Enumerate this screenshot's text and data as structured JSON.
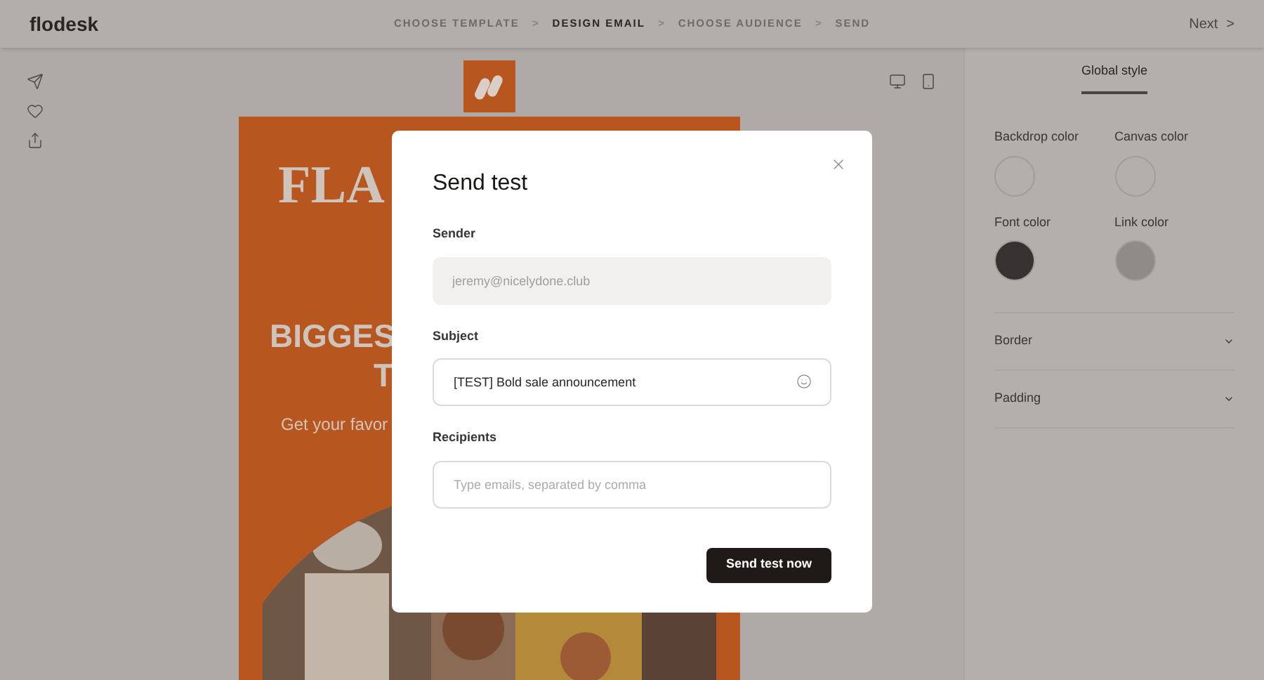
{
  "header": {
    "logo": "flodesk",
    "steps": [
      {
        "label": "CHOOSE TEMPLATE",
        "selected": false
      },
      {
        "label": "DESIGN EMAIL",
        "selected": true
      },
      {
        "label": "CHOOSE AUDIENCE",
        "selected": false
      },
      {
        "label": "SEND",
        "selected": false
      }
    ],
    "separator": ">",
    "next": "Next",
    "next_icon": ">"
  },
  "canvas": {
    "headline": "FLA",
    "title_lines": [
      "BIGGES",
      "T"
    ],
    "subtitle": "Get your favor",
    "image": {
      "kind": "picture"
    }
  },
  "panel": {
    "tabs": [
      {
        "label": "Global style",
        "selected": true
      }
    ],
    "swatches": [
      {
        "label": "Backdrop color",
        "color": "#b4afac"
      },
      {
        "label": "Canvas color",
        "color": "#b4afac"
      },
      {
        "label": "Font color",
        "color": "#363231"
      },
      {
        "label": "Link color",
        "color": "#8f8b89"
      }
    ],
    "sections": [
      {
        "label": "Border",
        "expanded": false
      },
      {
        "label": "Padding",
        "expanded": false
      }
    ]
  },
  "dialog": {
    "title": "Send test",
    "fields": [
      {
        "label": "Sender",
        "value": "jeremy@nicelydone.club",
        "disabled": true,
        "emoji": false
      },
      {
        "label": "Subject",
        "value": "[TEST] Bold sale announcement",
        "disabled": false,
        "emoji": true
      },
      {
        "label": "Recipients",
        "placeholder": "Type emails, separated by comma",
        "disabled": false,
        "emoji": false
      }
    ],
    "button": "Send test now"
  }
}
